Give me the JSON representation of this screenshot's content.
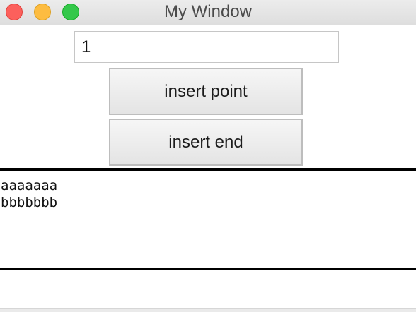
{
  "window": {
    "title": "My Window"
  },
  "traffic_lights": {
    "close_color": "#fc605c",
    "minimize_color": "#fdbc40",
    "maximize_color": "#34c84a"
  },
  "entry": {
    "value": "1"
  },
  "buttons": {
    "insert_point_label": "insert point",
    "insert_end_label": "insert end"
  },
  "text_area": {
    "lines": [
      "aaaaaaa",
      "bbbbbbb"
    ]
  }
}
